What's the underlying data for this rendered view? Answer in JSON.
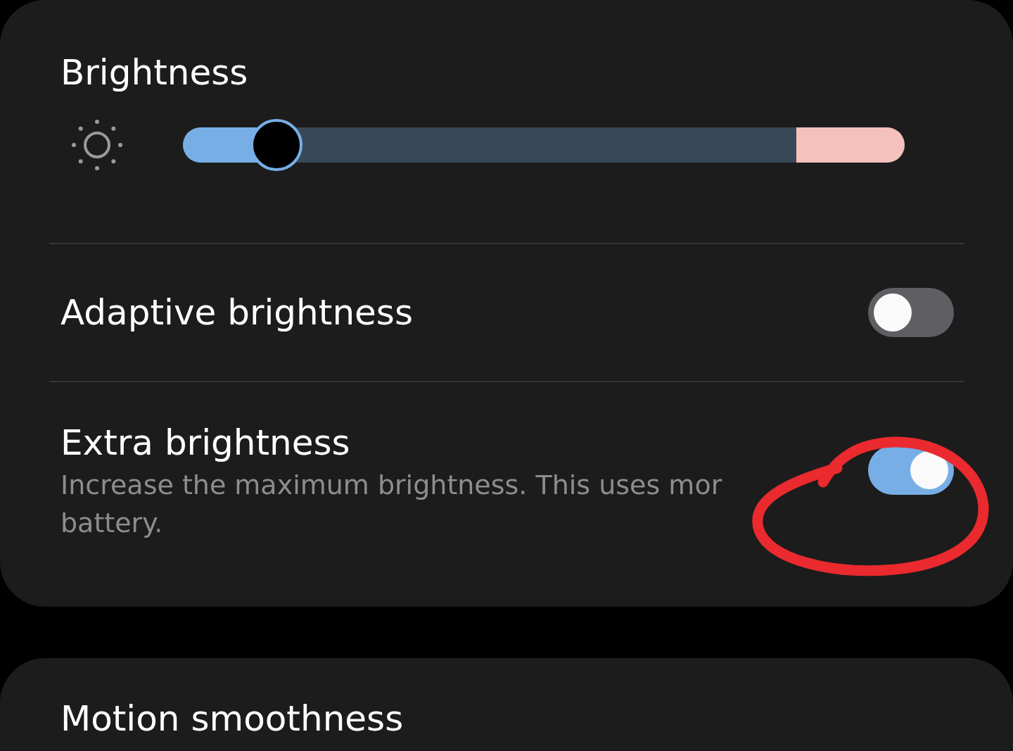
{
  "brightness_card": {
    "title": "Brightness",
    "slider": {
      "level": 0.13
    },
    "settings": [
      {
        "label": "Adaptive brightness",
        "on": false
      },
      {
        "label": "Extra brightness",
        "description": "Increase the maximum brightness. This uses mor\nbattery.",
        "on": true
      }
    ]
  },
  "motion_card": {
    "title": "Motion smoothness"
  }
}
